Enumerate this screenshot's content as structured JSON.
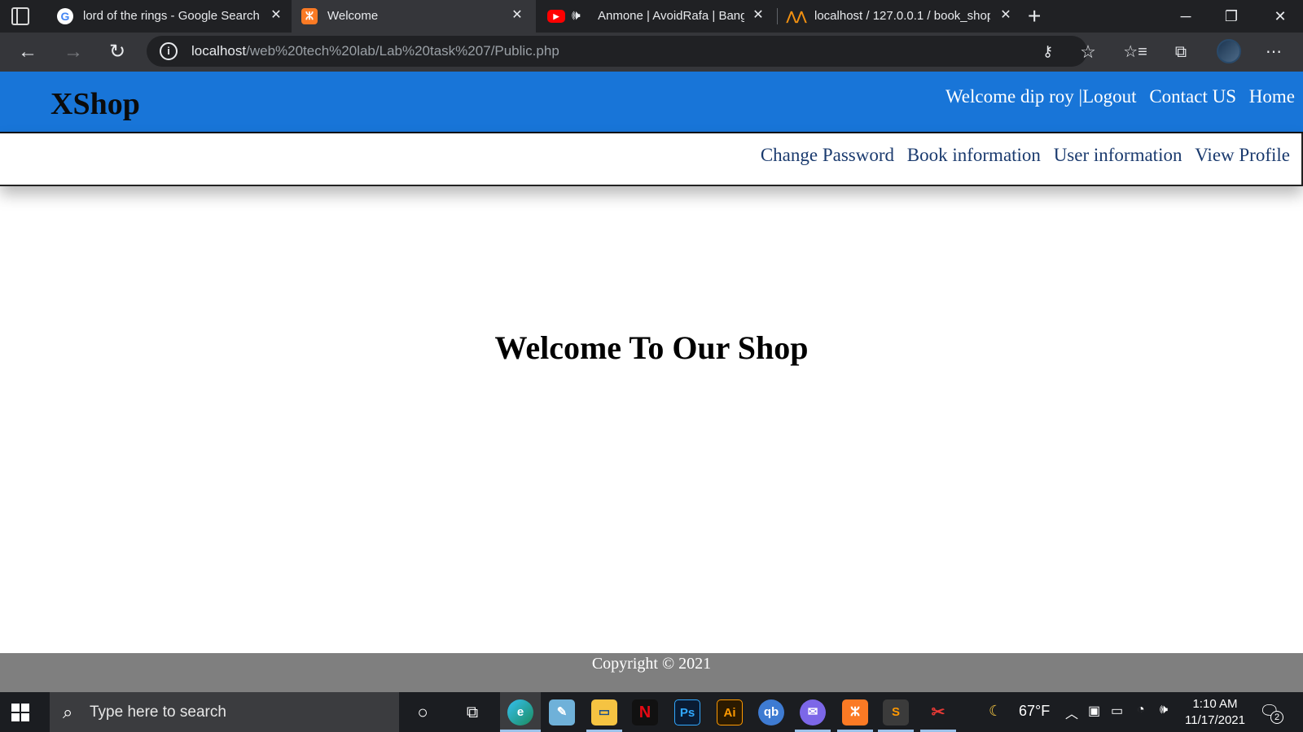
{
  "browser": {
    "tabs": [
      {
        "title": "lord of the rings - Google Search",
        "favicon": "google-icon"
      },
      {
        "title": "Welcome",
        "favicon": "xampp-icon",
        "active": true
      },
      {
        "title": "Anmone | AvoidRafa | Bangl",
        "favicon": "youtube-icon",
        "audio": "speaker-icon"
      },
      {
        "title": "localhost / 127.0.0.1 / book_shop",
        "favicon": "phpmyadmin-icon"
      }
    ],
    "url_host": "localhost",
    "url_path": "/web%20tech%20lab/Lab%20task%207/Public.php"
  },
  "site": {
    "logo": "XShop",
    "top_links": [
      "Welcome dip roy |",
      "Logout",
      "Contact US",
      "Home"
    ],
    "sub_links": [
      "Change Password",
      "Book information",
      "User information",
      "View Profile"
    ],
    "welcome": "Welcome To Our Shop",
    "footer": "Copyright © 2021"
  },
  "taskbar": {
    "search_placeholder": "Type here to search",
    "weather": "67°F",
    "time": "1:10 AM",
    "date": "11/17/2021",
    "notification_count": "2"
  },
  "colors": {
    "header_blue": "#1875d8",
    "footer_gray": "#7f7f7f",
    "link_navy": "#1a3a6e"
  }
}
